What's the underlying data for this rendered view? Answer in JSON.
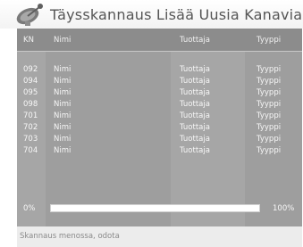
{
  "title": "Täysskannaus Lisää Uusia Kanavia",
  "header": {
    "kn": "KN",
    "name": "Nimi",
    "provider": "Tuottaja",
    "type": "Tyyppi"
  },
  "rows": [
    {
      "kn": "092",
      "name": "Nimi",
      "provider": "Tuottaja",
      "type": "Tyyppi"
    },
    {
      "kn": "094",
      "name": "Nimi",
      "provider": "Tuottaja",
      "type": "Tyyppi"
    },
    {
      "kn": "095",
      "name": "Nimi",
      "provider": "Tuottaja",
      "type": "Tyyppi"
    },
    {
      "kn": "098",
      "name": "Nimi",
      "provider": "Tuottaja",
      "type": "Tyyppi"
    },
    {
      "kn": "701",
      "name": "Nimi",
      "provider": "Tuottaja",
      "type": "Tyyppi"
    },
    {
      "kn": "702",
      "name": "Nimi",
      "provider": "Tuottaja",
      "type": "Tyyppi"
    },
    {
      "kn": "703",
      "name": "Nimi",
      "provider": "Tuottaja",
      "type": "Tyyppi"
    },
    {
      "kn": "704",
      "name": "Nimi",
      "provider": "Tuottaja",
      "type": "Tyyppi"
    }
  ],
  "progress": {
    "start_label": "0%",
    "end_label": "100%",
    "value": 1.0
  },
  "status": "Skannaus menossa, odota",
  "icons": {
    "logo": "satellite-dish-icon"
  },
  "colors": {
    "panel": "#9e9e9e",
    "header": "#8c8c8c",
    "progress_fill": "#ffffff"
  }
}
